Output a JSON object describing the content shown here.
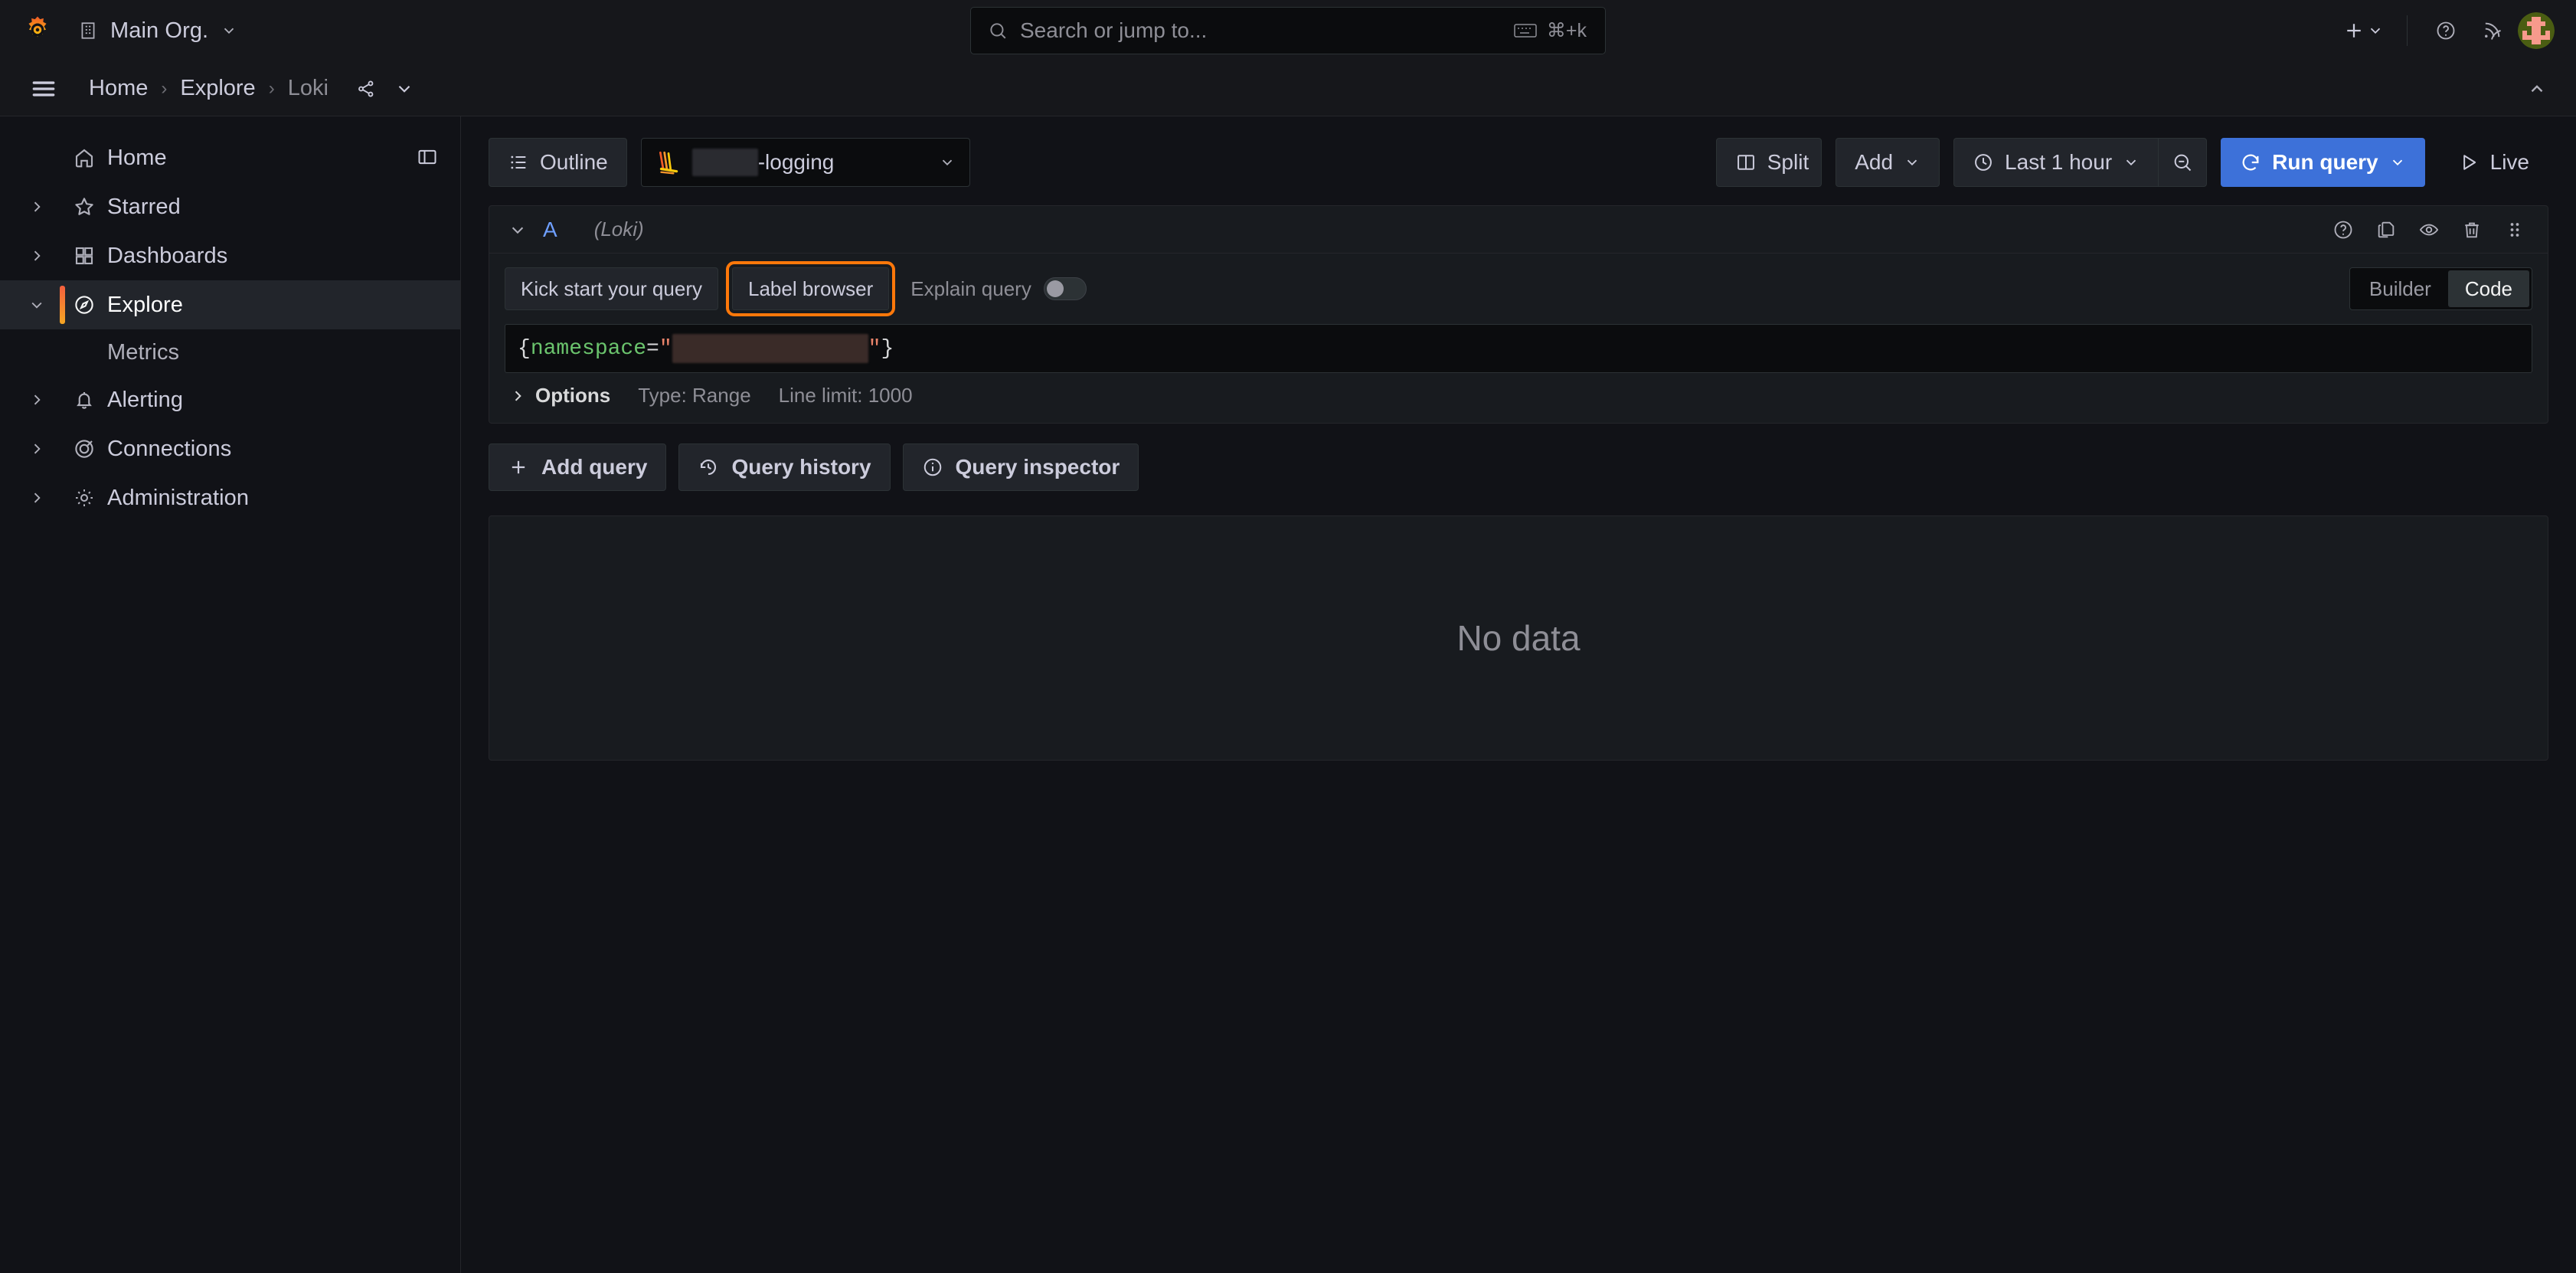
{
  "topbar": {
    "org_name": "Main Org.",
    "org_icon": "building-icon",
    "logo_icon": "grafana-logo-icon",
    "search": {
      "placeholder": "Search or jump to...",
      "icon": "search-icon",
      "shortcut": "⌘+k",
      "shortcut_icon": "keyboard-icon"
    },
    "actions": [
      {
        "name": "add-new-button",
        "icon": "plus-icon"
      },
      {
        "name": "help-button",
        "icon": "question-circle-icon"
      },
      {
        "name": "news-button",
        "icon": "rss-icon"
      },
      {
        "name": "profile-avatar",
        "icon": "avatar-icon"
      }
    ]
  },
  "breadcrumb": {
    "menu_icon": "hamburger-menu-icon",
    "items": [
      {
        "label": "Home",
        "current": false
      },
      {
        "label": "Explore",
        "current": false
      },
      {
        "label": "Loki",
        "current": true
      }
    ],
    "separator": "›",
    "share_icon": "share-alt-icon",
    "more_icon": "chevron-down-icon",
    "collapse_icon": "chevron-up-icon"
  },
  "sidebar": {
    "dock_icon": "dock-menu-icon",
    "items": [
      {
        "label": "Home",
        "icon": "home-icon",
        "expandable": false,
        "active": false,
        "expanded": false
      },
      {
        "label": "Starred",
        "icon": "star-icon",
        "expandable": true,
        "active": false,
        "expanded": false
      },
      {
        "label": "Dashboards",
        "icon": "apps-grid-icon",
        "expandable": true,
        "active": false,
        "expanded": false
      },
      {
        "label": "Explore",
        "icon": "compass-icon",
        "expandable": true,
        "active": true,
        "expanded": true
      },
      {
        "label": "Alerting",
        "icon": "bell-icon",
        "expandable": true,
        "active": false,
        "expanded": false
      },
      {
        "label": "Connections",
        "icon": "connections-icon",
        "expandable": true,
        "active": false,
        "expanded": false
      },
      {
        "label": "Administration",
        "icon": "gear-icon",
        "expandable": true,
        "active": false,
        "expanded": false
      }
    ],
    "sub_item": {
      "label": "Metrics",
      "parent": "Explore"
    }
  },
  "toolbar": {
    "outline_label": "Outline",
    "outline_icon": "list-outline-icon",
    "datasource": {
      "name_suffix": "-logging",
      "name_prefix_redacted": true,
      "logo_icon": "loki-logo-icon",
      "chevron_icon": "chevron-down-icon"
    },
    "split_label": "Split",
    "split_icon": "columns-icon",
    "add_label": "Add",
    "add_chevron_icon": "chevron-down-icon",
    "time_range_label": "Last 1 hour",
    "time_range_icon": "clock-icon",
    "time_range_chevron_icon": "chevron-down-icon",
    "zoom_out_icon": "search-minus-icon",
    "run_query_label": "Run query",
    "run_query_icon": "sync-refresh-icon",
    "run_query_chevron_icon": "chevron-down-icon",
    "run_query_color": "#3d71d9",
    "live_label": "Live",
    "live_icon": "play-icon"
  },
  "query": {
    "ref_id": "A",
    "datasource_label": "(Loki)",
    "collapse_icon": "chevron-down-icon",
    "row_actions": [
      {
        "name": "query-help-button",
        "icon": "question-circle-icon"
      },
      {
        "name": "duplicate-query-button",
        "icon": "copy-icon"
      },
      {
        "name": "toggle-query-button",
        "icon": "eye-icon"
      },
      {
        "name": "remove-query-button",
        "icon": "trash-icon"
      },
      {
        "name": "drag-query-handle",
        "icon": "drag-dots-icon"
      }
    ],
    "kickstart_label": "Kick start your query",
    "label_browser_label": "Label browser",
    "label_browser_focused": true,
    "focus_ring_color": "#ff780a",
    "explain_query_label": "Explain query",
    "explain_query_enabled": false,
    "mode_tabs": [
      {
        "label": "Builder",
        "selected": false
      },
      {
        "label": "Code",
        "selected": true
      }
    ],
    "expression": {
      "open_brace": "{",
      "label": "namespace",
      "equals": "=",
      "quote": "\"",
      "value_redacted": true,
      "close_brace": "}"
    },
    "options": {
      "title": "Options",
      "expand_icon": "chevron-right-icon",
      "type": "Type: Range",
      "line_limit": "Line limit: 1000"
    },
    "actions": [
      {
        "label": "Add query",
        "icon": "plus-icon",
        "name": "add-query-button"
      },
      {
        "label": "Query history",
        "icon": "history-icon",
        "name": "query-history-button"
      },
      {
        "label": "Query inspector",
        "icon": "info-circle-icon",
        "name": "query-inspector-button"
      }
    ]
  },
  "results": {
    "empty_message": "No data"
  },
  "colors": {
    "background": "#111217",
    "panel": "#181b1f",
    "border": "#25262b",
    "accent_orange": "#ff780a",
    "accent_blue": "#3d71d9",
    "text_primary": "#ccccdc",
    "text_secondary": "#8e8e96"
  }
}
